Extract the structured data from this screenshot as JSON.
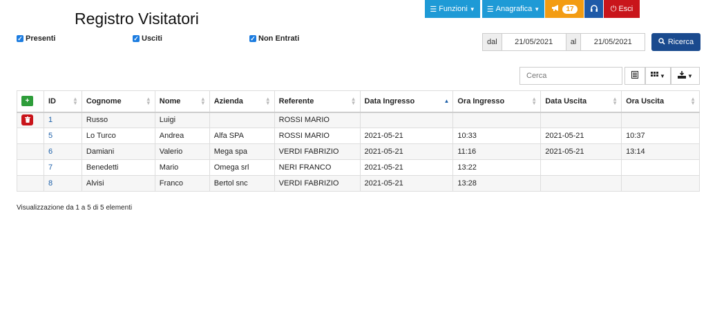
{
  "header": {
    "title": "Registro Visitatori"
  },
  "nav": {
    "funzioni": "Funzioni",
    "anagrafica": "Anagrafica",
    "alert_count": "17",
    "esci": "Esci"
  },
  "filters": {
    "presenti": "Presenti",
    "usciti": "Usciti",
    "non_entrati": "Non Entrati"
  },
  "dates": {
    "from_label": "dal",
    "from_value": "21/05/2021",
    "to_label": "al",
    "to_value": "21/05/2021",
    "search_button": "Ricerca"
  },
  "search": {
    "placeholder": "Cerca"
  },
  "table": {
    "columns": [
      "ID",
      "Cognome",
      "Nome",
      "Azienda",
      "Referente",
      "Data Ingresso",
      "Ora Ingresso",
      "Data Uscita",
      "Ora Uscita"
    ],
    "rows": [
      [
        "1",
        "Russo",
        "Luigi",
        "",
        "ROSSI MARIO",
        "",
        "",
        "",
        ""
      ],
      [
        "5",
        "Lo Turco",
        "Andrea",
        "Alfa SPA",
        "ROSSI MARIO",
        "2021-05-21",
        "10:33",
        "2021-05-21",
        "10:37"
      ],
      [
        "6",
        "Damiani",
        "Valerio",
        "Mega spa",
        "VERDI FABRIZIO",
        "2021-05-21",
        "11:16",
        "2021-05-21",
        "13:14"
      ],
      [
        "7",
        "Benedetti",
        "Mario",
        "Omega srl",
        "NERI FRANCO",
        "2021-05-21",
        "13:22",
        "",
        ""
      ],
      [
        "8",
        "Alvisi",
        "Franco",
        "Bertol snc",
        "VERDI FABRIZIO",
        "2021-05-21",
        "13:28",
        "",
        ""
      ]
    ]
  },
  "footer": {
    "info": "Visualizzazione da 1 a 5 di 5 elementi"
  }
}
